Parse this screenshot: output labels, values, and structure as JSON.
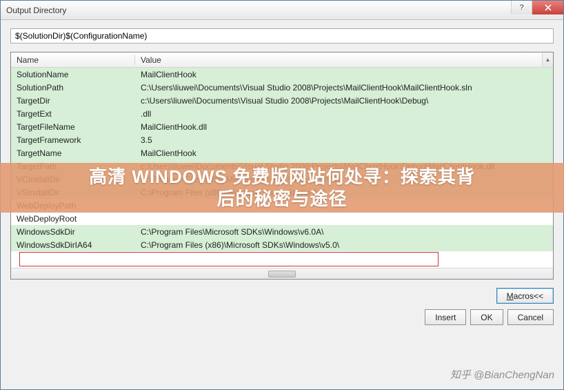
{
  "window": {
    "title": "Output Directory"
  },
  "input": {
    "value": "$(SolutionDir)$(ConfigurationName)"
  },
  "columns": {
    "name": "Name",
    "value": "Value"
  },
  "rows": [
    {
      "name": "SolutionName",
      "value": "MailClientHook",
      "green": true
    },
    {
      "name": "SolutionPath",
      "value": "C:\\Users\\liuwei\\Documents\\Visual Studio 2008\\Projects\\MailClientHook\\MailClientHook.sln",
      "green": true
    },
    {
      "name": "TargetDir",
      "value": "c:\\Users\\liuwei\\Documents\\Visual Studio 2008\\Projects\\MailClientHook\\Debug\\",
      "green": true
    },
    {
      "name": "TargetExt",
      "value": ".dll",
      "green": true
    },
    {
      "name": "TargetFileName",
      "value": "MailClientHook.dll",
      "green": true
    },
    {
      "name": "TargetFramework",
      "value": "3.5",
      "green": true
    },
    {
      "name": "TargetName",
      "value": "MailClientHook",
      "green": true
    },
    {
      "name": "TargetPath",
      "value": "c:\\Users\\liuwei\\Documents\\Visual Studio 2008\\Projects\\MailClientHook\\Debug\\MailClientHook.dll",
      "green": true
    },
    {
      "name": "VCInstallDir",
      "value": "C:\\Program Files (x86)\\Microsoft Visual Studio 9.0\\VC\\",
      "green": true
    },
    {
      "name": "VSInstallDir",
      "value": "C:\\Program Files (x86)\\Microsoft Visual Studio 9.0\\",
      "green": true
    },
    {
      "name": "WebDeployPath",
      "value": "",
      "green": false
    },
    {
      "name": "WebDeployRoot",
      "value": "",
      "green": false
    },
    {
      "name": "WindowsSdkDir",
      "value": "C:\\Program Files\\Microsoft SDKs\\Windows\\v6.0A\\",
      "green": true
    },
    {
      "name": "WindowsSdkDirIA64",
      "value": "C:\\Program Files (x86)\\Microsoft SDKs\\Windows\\v5.0\\",
      "green": true
    }
  ],
  "buttons": {
    "macros": "Macros<<",
    "insert": "Insert",
    "ok": "OK",
    "cancel": "Cancel"
  },
  "overlay": {
    "line1": "高清 WINDOWS 免费版网站何处寻：探索其背",
    "line2": "后的秘密与途径"
  },
  "watermark": "知乎 @BianChengNan"
}
